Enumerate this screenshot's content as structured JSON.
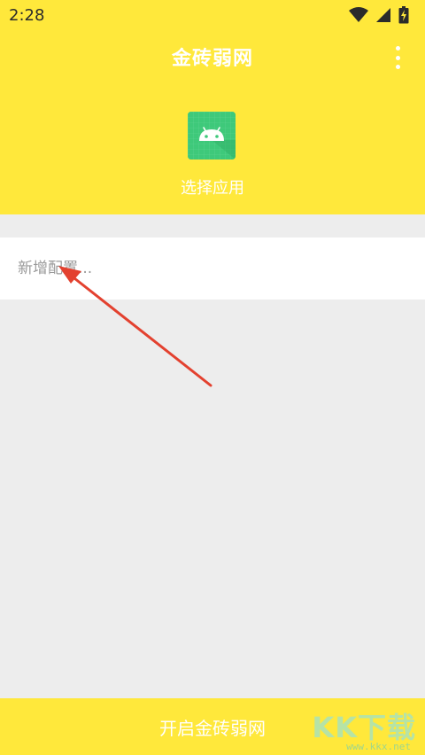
{
  "status_bar": {
    "time": "2:28",
    "icons": [
      "wifi-icon",
      "cellular-signal-icon",
      "battery-charging-icon"
    ]
  },
  "app_bar": {
    "title": "金砖弱网",
    "menu_icon": "more-vert-icon"
  },
  "app_selector": {
    "icon": "android-icon",
    "label": "选择应用"
  },
  "config": {
    "placeholder": "新增配置...",
    "value": ""
  },
  "footer": {
    "start_button_label": "开启金砖弱网"
  },
  "watermark": {
    "logo_text": "KK下载",
    "url": "www.kkx.net"
  },
  "colors": {
    "accent": "#ffe83b",
    "background": "#ededed",
    "icon_green": "#3ec97a",
    "annotation_arrow": "#e3412f"
  }
}
